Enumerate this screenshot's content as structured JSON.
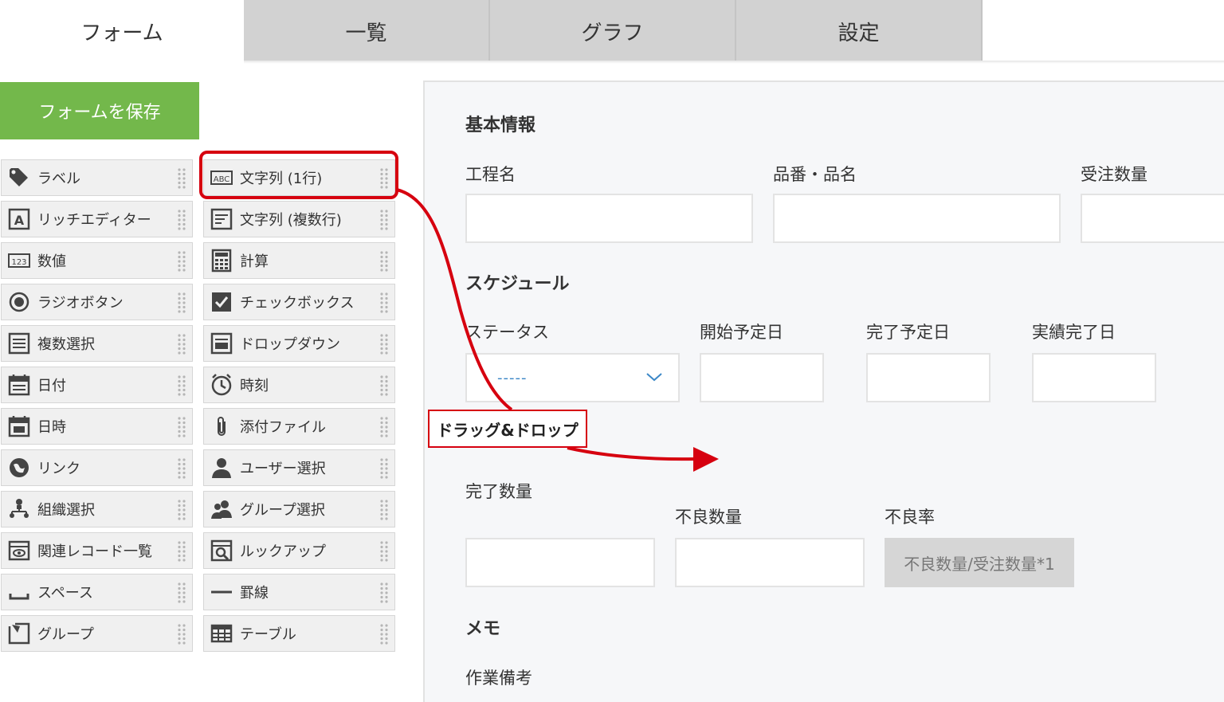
{
  "tabs": [
    {
      "label": "フォーム",
      "active": true
    },
    {
      "label": "一覧",
      "active": false
    },
    {
      "label": "グラフ",
      "active": false
    },
    {
      "label": "設定",
      "active": false
    }
  ],
  "save_button": "フォームを保存",
  "palette": {
    "left": [
      {
        "label": "ラベル",
        "icon": "tag-icon"
      },
      {
        "label": "リッチエディター",
        "icon": "rich-editor-icon"
      },
      {
        "label": "数値",
        "icon": "number-icon"
      },
      {
        "label": "ラジオボタン",
        "icon": "radio-icon"
      },
      {
        "label": "複数選択",
        "icon": "multi-select-icon"
      },
      {
        "label": "日付",
        "icon": "date-icon"
      },
      {
        "label": "日時",
        "icon": "datetime-icon"
      },
      {
        "label": "リンク",
        "icon": "link-icon"
      },
      {
        "label": "組織選択",
        "icon": "org-select-icon"
      },
      {
        "label": "関連レコード一覧",
        "icon": "related-records-icon"
      },
      {
        "label": "スペース",
        "icon": "space-icon"
      },
      {
        "label": "グループ",
        "icon": "group-icon"
      }
    ],
    "right": [
      {
        "label": "文字列 (1行)",
        "icon": "abc-text-icon"
      },
      {
        "label": "文字列 (複数行)",
        "icon": "multiline-text-icon"
      },
      {
        "label": "計算",
        "icon": "calculator-icon"
      },
      {
        "label": "チェックボックス",
        "icon": "checkbox-icon"
      },
      {
        "label": "ドロップダウン",
        "icon": "dropdown-icon"
      },
      {
        "label": "時刻",
        "icon": "clock-icon"
      },
      {
        "label": "添付ファイル",
        "icon": "paperclip-icon"
      },
      {
        "label": "ユーザー選択",
        "icon": "user-icon"
      },
      {
        "label": "グループ選択",
        "icon": "users-icon"
      },
      {
        "label": "ルックアップ",
        "icon": "lookup-icon"
      },
      {
        "label": "罫線",
        "icon": "line-icon"
      },
      {
        "label": "テーブル",
        "icon": "table-icon"
      }
    ]
  },
  "form": {
    "basic_section": "基本情報",
    "process_name": "工程名",
    "part_name": "品番・品名",
    "order_qty": "受注数量",
    "schedule_section": "スケジュール",
    "status": "ステータス",
    "status_value": "-----",
    "start_date": "開始予定日",
    "end_date": "完了予定日",
    "actual_end": "実績完了日",
    "done_qty": "完了数量",
    "defect_qty": "不良数量",
    "defect_rate": "不良率",
    "defect_rate_formula": "不良数量/受注数量*1",
    "memo_section": "メモ",
    "work_notes": "作業備考"
  },
  "annotation": {
    "label": "ドラッグ&ドロップ",
    "color": "#d6000f"
  }
}
